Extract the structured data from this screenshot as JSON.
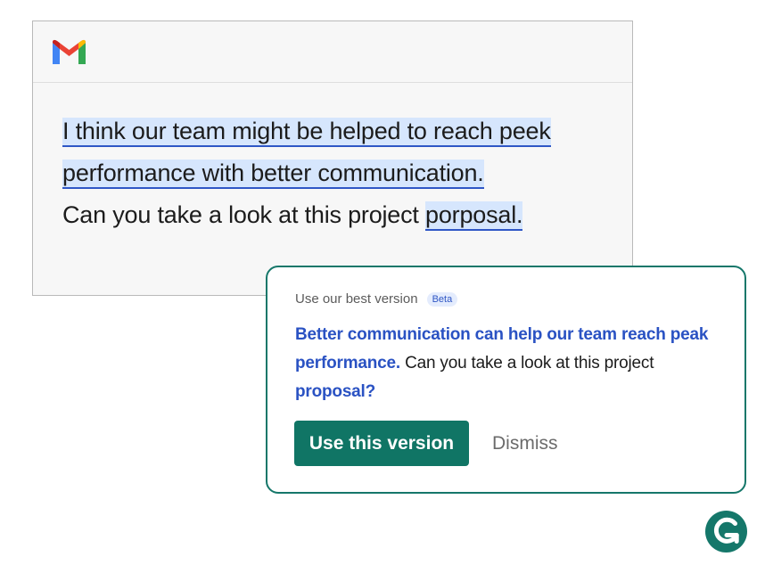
{
  "email": {
    "lines": [
      {
        "highlighted": "I think our team might be helped to reach peek"
      },
      {
        "highlighted": "performance with better communication."
      },
      {
        "plain": "Can you take a look at this project ",
        "highlighted": "porposal."
      }
    ]
  },
  "suggestion": {
    "heading": "Use our best version",
    "badge": "Beta",
    "segments": {
      "s1": "Better communication can help our team reach peak performance.",
      "s2": " Can you take a look at this project ",
      "s3": "proposal?"
    },
    "use_button": "Use this version",
    "dismiss_button": "Dismiss"
  },
  "icons": {
    "gmail": "gmail-icon",
    "grammarly": "grammarly-icon"
  },
  "colors": {
    "accent_green": "#107565",
    "card_border": "#15776a",
    "highlight_bg": "#d6e6fd",
    "highlight_underline": "#2f57c6",
    "suggestion_blue": "#2a52c3"
  }
}
